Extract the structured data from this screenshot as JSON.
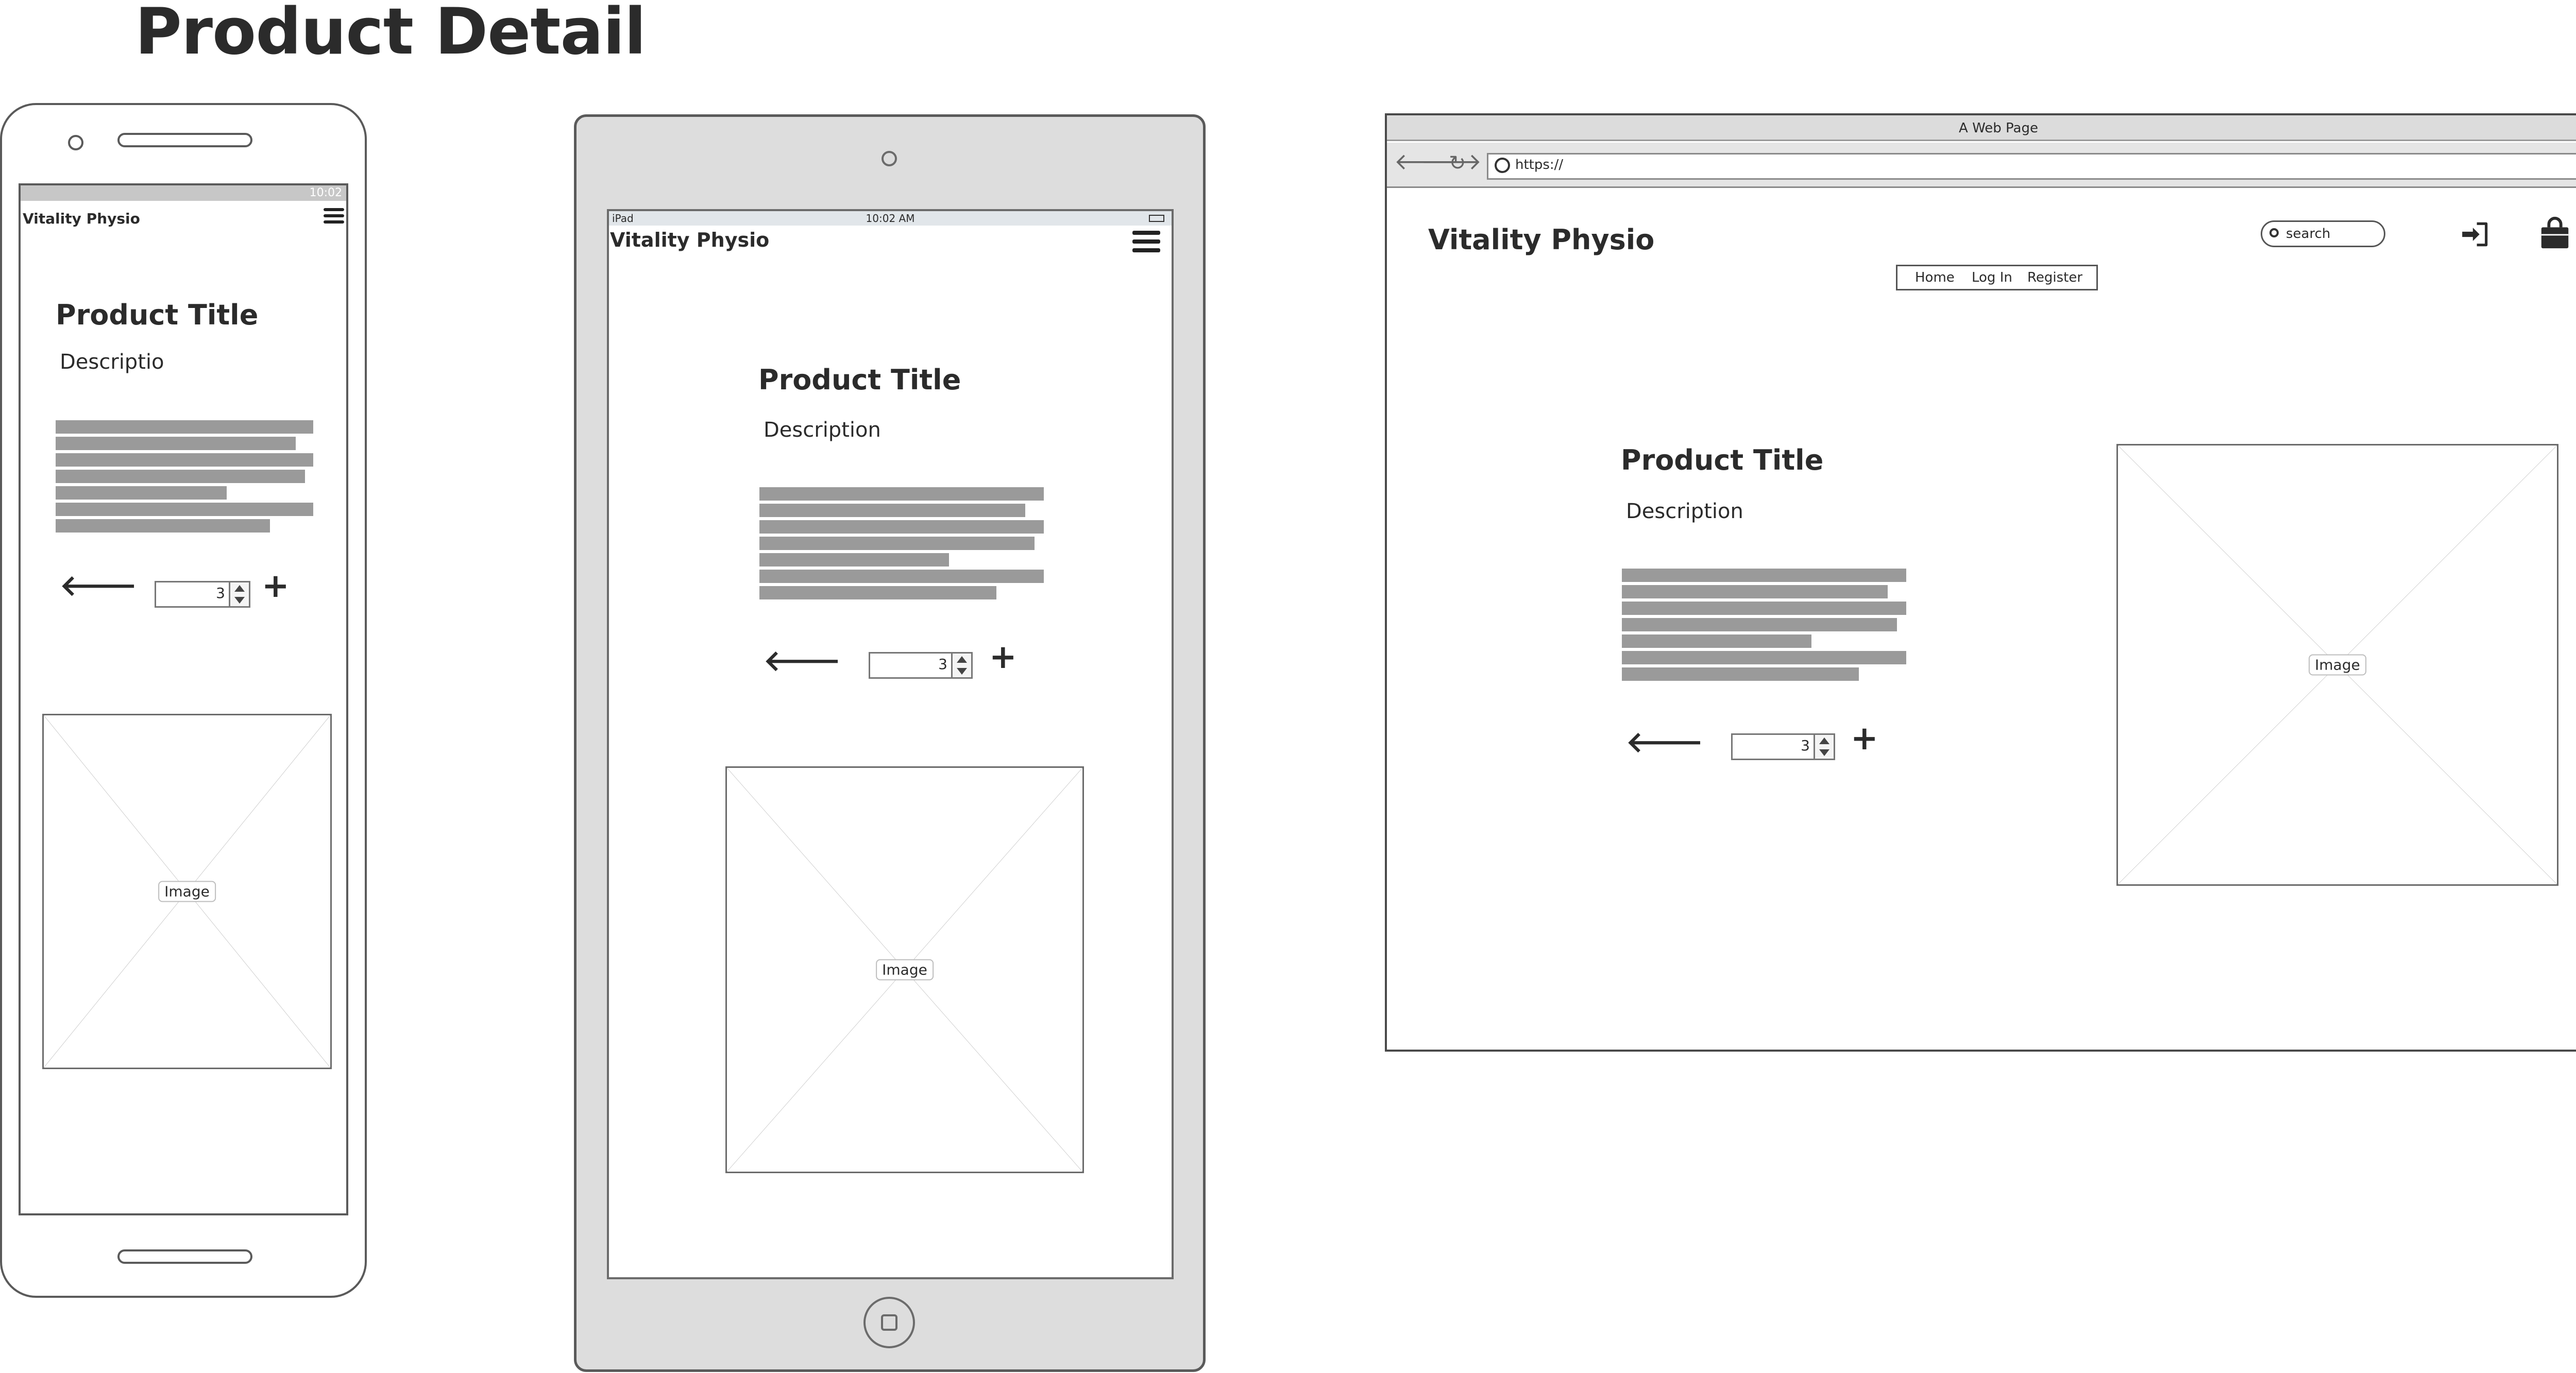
{
  "page": {
    "title": "Product Detail"
  },
  "phone": {
    "status_time": "10:02",
    "brand": "Vitality Physio",
    "product_title": "Product Title",
    "description": "Descriptio",
    "quantity": "3",
    "image_label": "Image"
  },
  "tablet": {
    "status_left": "iPad",
    "status_time": "10:02 AM",
    "brand": "Vitality Physio",
    "product_title": "Product Title",
    "description": "Description",
    "quantity": "3",
    "image_label": "Image"
  },
  "browser": {
    "window_title": "A Web Page",
    "url": "https://",
    "brand": "Vitality Physio",
    "search_placeholder": "search",
    "nav": {
      "home": "Home",
      "login": "Log In",
      "register": "Register"
    },
    "product_title": "Product Title",
    "description": "Description",
    "quantity": "3",
    "image_label": "Image"
  },
  "icons": {
    "back": "arrow-left-icon",
    "add": "plus-icon",
    "menu": "hamburger-menu-icon",
    "login": "sign-in-icon",
    "cart": "shopping-bag-icon",
    "search": "search-icon"
  },
  "colors": {
    "placeholder_bar": "#9a9a9a",
    "device_gray": "#dddddd",
    "stroke": "#5a5a5a"
  }
}
